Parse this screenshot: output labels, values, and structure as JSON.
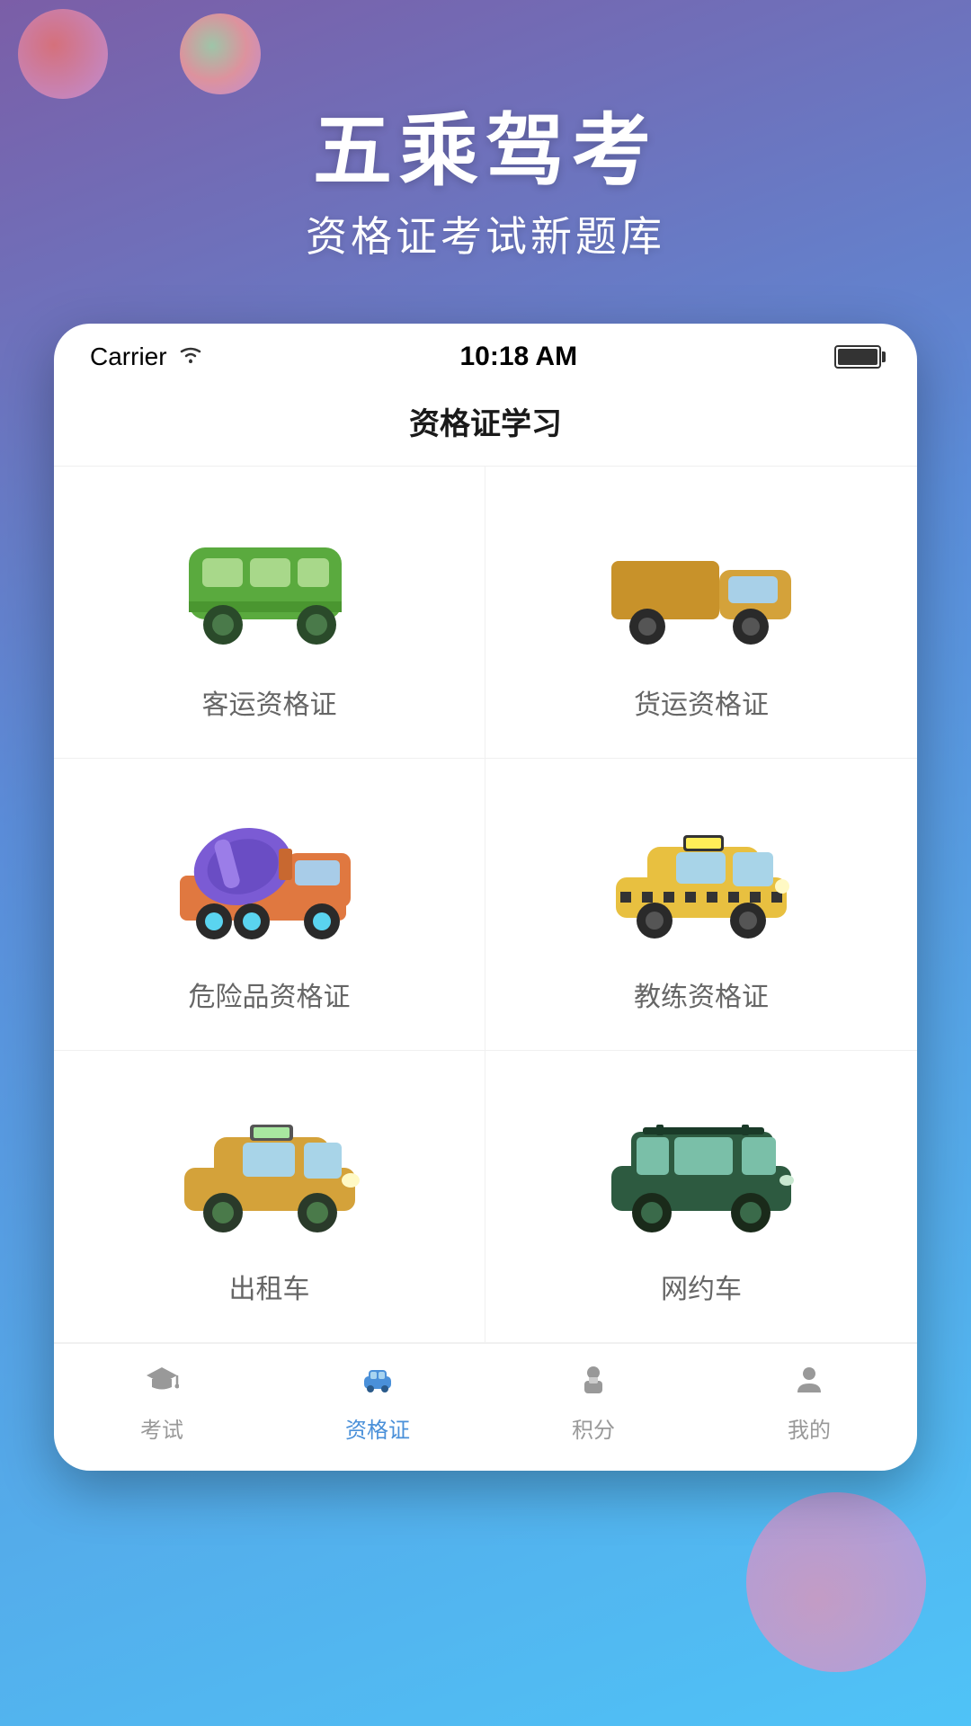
{
  "background": {
    "gradient_start": "#7b5ea7",
    "gradient_end": "#4fc3f7"
  },
  "header": {
    "title": "五乘驾考",
    "subtitle": "资格证考试新题库"
  },
  "status_bar": {
    "carrier": "Carrier",
    "wifi": "wifi",
    "time": "10:18 AM",
    "battery": "full"
  },
  "page_title": "资格证学习",
  "grid_items": [
    {
      "id": "passenger",
      "label": "客运资格证",
      "color": "#6aaa5a"
    },
    {
      "id": "freight",
      "label": "货运资格证",
      "color": "#d4a23a"
    },
    {
      "id": "hazmat",
      "label": "危险品资格证",
      "color": "#e07840"
    },
    {
      "id": "trainer",
      "label": "教练资格证",
      "color": "#e8c040"
    },
    {
      "id": "taxi",
      "label": "出租车",
      "color": "#d4a23a"
    },
    {
      "id": "rideshare",
      "label": "网约车",
      "color": "#2d5a40"
    }
  ],
  "tabs": [
    {
      "id": "exam",
      "label": "考试",
      "icon": "graduation-cap",
      "active": false
    },
    {
      "id": "certificate",
      "label": "资格证",
      "icon": "car",
      "active": true
    },
    {
      "id": "points",
      "label": "积分",
      "icon": "person-badge",
      "active": false
    },
    {
      "id": "mine",
      "label": "我的",
      "icon": "person",
      "active": false
    }
  ]
}
